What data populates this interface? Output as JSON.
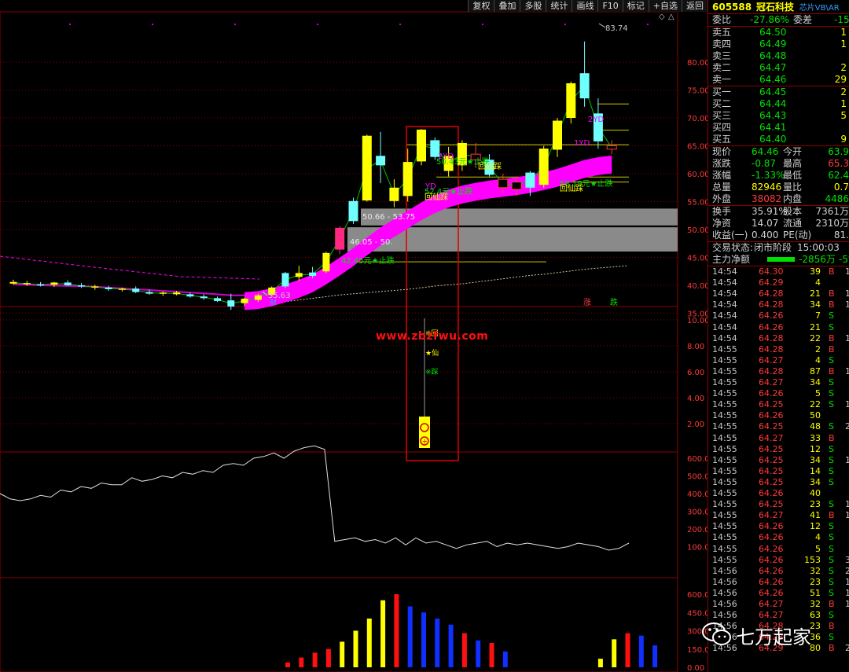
{
  "toolbar": [
    "复权",
    "叠加",
    "多股",
    "统计",
    "画线",
    "F10",
    "标记",
    "+自选",
    "返回"
  ],
  "stock": {
    "code": "605588",
    "name": "冠石科技",
    "tag": "芯片VB\\AR"
  },
  "weibi": {
    "label": "委比",
    "value": "-27.86%",
    "label2": "委差",
    "value2": "-15"
  },
  "asks": [
    {
      "label": "卖五",
      "price": "64.50",
      "vol": "1"
    },
    {
      "label": "卖四",
      "price": "64.49",
      "vol": "1"
    },
    {
      "label": "卖三",
      "price": "64.48",
      "vol": ""
    },
    {
      "label": "卖二",
      "price": "64.47",
      "vol": "2"
    },
    {
      "label": "卖一",
      "price": "64.46",
      "vol": "29"
    }
  ],
  "bids": [
    {
      "label": "买一",
      "price": "64.45",
      "vol": "2"
    },
    {
      "label": "买二",
      "price": "64.44",
      "vol": "1"
    },
    {
      "label": "买三",
      "price": "64.43",
      "vol": "5"
    },
    {
      "label": "买四",
      "price": "64.41",
      "vol": ""
    },
    {
      "label": "买五",
      "price": "64.40",
      "vol": "9"
    }
  ],
  "quote": [
    {
      "l1": "现价",
      "v1": "64.46",
      "l2": "今开",
      "v2": "63.9"
    },
    {
      "l1": "涨跌",
      "v1": "-0.87",
      "l2": "最高",
      "v2": "65.3"
    },
    {
      "l1": "涨幅",
      "v1": "-1.33%",
      "l2": "最低",
      "v2": "62.4"
    },
    {
      "l1": "总量",
      "v1": "82946",
      "l2": "量比",
      "v2": "0.7"
    },
    {
      "l1": "外盘",
      "v1": "38082",
      "l2": "内盘",
      "v2": "4486"
    }
  ],
  "stats": [
    {
      "l1": "换手",
      "v1": "35.91%",
      "l2": "股本",
      "v2": "7361万"
    },
    {
      "l1": "净资",
      "v1": "14.07",
      "l2": "流通",
      "v2": "2310万"
    },
    {
      "l1": "收益(一)",
      "v1": "0.400",
      "l2": "PE(动)",
      "v2": "81."
    }
  ],
  "status": {
    "label": "交易状态:",
    "value": "闭市阶段",
    "time": "15:00:03"
  },
  "mainflow": {
    "label": "主力净额",
    "value": "-2856万",
    "pct": "-5%"
  },
  "ticks": [
    [
      "14:54",
      "64.30",
      "39",
      "B",
      "1"
    ],
    [
      "14:54",
      "64.29",
      "4",
      "",
      ""
    ],
    [
      "14:54",
      "64.28",
      "21",
      "B",
      "1"
    ],
    [
      "14:54",
      "64.28",
      "34",
      "B",
      "1"
    ],
    [
      "14:54",
      "64.26",
      "7",
      "S",
      ""
    ],
    [
      "14:54",
      "64.26",
      "21",
      "S",
      ""
    ],
    [
      "14:54",
      "64.28",
      "22",
      "B",
      "1"
    ],
    [
      "14:55",
      "64.28",
      "2",
      "B",
      ""
    ],
    [
      "14:55",
      "64.27",
      "4",
      "S",
      ""
    ],
    [
      "14:55",
      "64.28",
      "87",
      "B",
      "1"
    ],
    [
      "14:55",
      "64.27",
      "34",
      "S",
      ""
    ],
    [
      "14:55",
      "64.26",
      "5",
      "S",
      ""
    ],
    [
      "14:55",
      "64.25",
      "22",
      "S",
      "1"
    ],
    [
      "14:55",
      "64.26",
      "50",
      "",
      ""
    ],
    [
      "14:55",
      "64.25",
      "48",
      "S",
      "2"
    ],
    [
      "14:55",
      "64.27",
      "33",
      "B",
      ""
    ],
    [
      "14:55",
      "64.25",
      "12",
      "S",
      ""
    ],
    [
      "14:55",
      "64.25",
      "34",
      "S",
      "1"
    ],
    [
      "14:55",
      "64.25",
      "14",
      "S",
      ""
    ],
    [
      "14:55",
      "64.25",
      "34",
      "S",
      ""
    ],
    [
      "14:55",
      "64.26",
      "40",
      "",
      ""
    ],
    [
      "14:55",
      "64.25",
      "23",
      "S",
      "1"
    ],
    [
      "14:55",
      "64.27",
      "41",
      "B",
      "1"
    ],
    [
      "14:55",
      "64.26",
      "12",
      "S",
      ""
    ],
    [
      "14:55",
      "64.26",
      "4",
      "S",
      ""
    ],
    [
      "14:55",
      "64.26",
      "5",
      "S",
      ""
    ],
    [
      "14:55",
      "64.26",
      "153",
      "S",
      "3"
    ],
    [
      "14:56",
      "64.26",
      "32",
      "S",
      "2"
    ],
    [
      "14:56",
      "64.26",
      "23",
      "S",
      "1"
    ],
    [
      "14:56",
      "64.26",
      "51",
      "S",
      "1"
    ],
    [
      "14:56",
      "64.27",
      "32",
      "B",
      "1"
    ],
    [
      "14:56",
      "64.27",
      "63",
      "S",
      ""
    ],
    [
      "14:56",
      "64.28",
      "23",
      "B",
      ""
    ],
    [
      "14:56",
      "64.28",
      "36",
      "S",
      ""
    ],
    [
      "14:56",
      "64.29",
      "80",
      "B",
      "2"
    ]
  ],
  "price_axis": [
    "80.00",
    "75.00",
    "70.00",
    "65.00",
    "60.00",
    "55.00",
    "50.00",
    "45.00",
    "40.00",
    "35.00"
  ],
  "ind1_axis": [
    "10.00",
    "8.00",
    "6.00",
    "4.00",
    "2.00"
  ],
  "ind2_axis": [
    "600.0",
    "500.0",
    "400.0",
    "300.0",
    "200.0",
    "100.0"
  ],
  "ind3_axis": [
    "600.0",
    "450.0",
    "300.0",
    "150.0",
    "0.00"
  ],
  "annotations": {
    "high": "83.74",
    "low": "35.63",
    "cai": "财",
    "zhang": "涨",
    "die": "跌",
    "box1": "50.66 - 53.75",
    "box2": "46.05 - 50.",
    "zhidie1": "42.45元★止跌",
    "zhidie2": "50.43元★止跌",
    "zhidie3": "52.4元★止跌",
    "zhidie4": "58.19元★止跌",
    "hxd": "回仙踩",
    "yd": "YD",
    "yd1": "1YD",
    "yd2": "2YD",
    "ind_hui": "回",
    "ind_xian": "仙",
    "ind_cai": "踩"
  },
  "watermark": "www.zbzfwu.com",
  "logo": "七万起家",
  "colors": {
    "up": "#ff3a3a",
    "down": "#00e000",
    "ma": "#ff00ff",
    "frame": "#8b0000"
  },
  "chart_data": {
    "type": "candlestick",
    "candles": [
      {
        "o": 40.6,
        "h": 41.0,
        "l": 40.1,
        "c": 40.3,
        "col": "y"
      },
      {
        "o": 40.4,
        "h": 40.8,
        "l": 39.9,
        "c": 40.2,
        "col": "y"
      },
      {
        "o": 40.2,
        "h": 40.6,
        "l": 39.8,
        "c": 40.0,
        "col": "c"
      },
      {
        "o": 40.1,
        "h": 40.6,
        "l": 39.7,
        "c": 40.5,
        "col": "y"
      },
      {
        "o": 40.5,
        "h": 40.9,
        "l": 39.9,
        "c": 40.0,
        "col": "c"
      },
      {
        "o": 40.0,
        "h": 40.4,
        "l": 39.5,
        "c": 39.8,
        "col": "c"
      },
      {
        "o": 39.8,
        "h": 40.1,
        "l": 39.2,
        "c": 39.6,
        "col": "y"
      },
      {
        "o": 39.6,
        "h": 39.9,
        "l": 39.0,
        "c": 39.3,
        "col": "c"
      },
      {
        "o": 39.2,
        "h": 39.6,
        "l": 38.9,
        "c": 39.4,
        "col": "y"
      },
      {
        "o": 39.4,
        "h": 39.8,
        "l": 38.6,
        "c": 38.8,
        "col": "c"
      },
      {
        "o": 38.8,
        "h": 39.2,
        "l": 38.3,
        "c": 38.5,
        "col": "c"
      },
      {
        "o": 38.5,
        "h": 38.9,
        "l": 38.1,
        "c": 38.7,
        "col": "y"
      },
      {
        "o": 38.7,
        "h": 39.0,
        "l": 38.2,
        "c": 38.4,
        "col": "y"
      },
      {
        "o": 38.4,
        "h": 38.7,
        "l": 37.8,
        "c": 38.0,
        "col": "c"
      },
      {
        "o": 38.0,
        "h": 38.4,
        "l": 37.4,
        "c": 37.7,
        "col": "c"
      },
      {
        "o": 37.7,
        "h": 38.0,
        "l": 37.0,
        "c": 37.2,
        "col": "c"
      },
      {
        "o": 37.3,
        "h": 38.5,
        "l": 35.6,
        "c": 36.2,
        "col": "c"
      },
      {
        "o": 36.8,
        "h": 37.8,
        "l": 36.3,
        "c": 37.6,
        "col": "y"
      },
      {
        "o": 37.4,
        "h": 38.5,
        "l": 37.0,
        "c": 38.2,
        "col": "y"
      },
      {
        "o": 38.3,
        "h": 39.8,
        "l": 38.1,
        "c": 39.6,
        "col": "y"
      },
      {
        "o": 39.8,
        "h": 42.4,
        "l": 39.5,
        "c": 42.2,
        "col": "c"
      },
      {
        "o": 42.2,
        "h": 43.5,
        "l": 40.8,
        "c": 41.5,
        "col": "y"
      },
      {
        "o": 41.7,
        "h": 43.3,
        "l": 41.3,
        "c": 42.3,
        "col": "c"
      },
      {
        "o": 42.5,
        "h": 46.0,
        "l": 42.2,
        "c": 45.8,
        "col": "y"
      },
      {
        "o": 46.4,
        "h": 50.6,
        "l": 45.6,
        "c": 50.3,
        "col": "m"
      },
      {
        "o": 51.5,
        "h": 55.7,
        "l": 51.0,
        "c": 55.1,
        "col": "c"
      },
      {
        "o": 55.2,
        "h": 67.0,
        "l": 55.0,
        "c": 66.8,
        "col": "y"
      },
      {
        "o": 63.2,
        "h": 67.5,
        "l": 58.3,
        "c": 61.5,
        "col": "c"
      },
      {
        "o": 57.5,
        "h": 59.0,
        "l": 54.0,
        "c": 55.1,
        "col": "y"
      },
      {
        "o": 56.0,
        "h": 64.5,
        "l": 55.0,
        "c": 62.1,
        "col": "y"
      },
      {
        "o": 62.2,
        "h": 68.0,
        "l": 61.5,
        "c": 67.9,
        "col": "y"
      },
      {
        "o": 66.0,
        "h": 66.5,
        "l": 62.5,
        "c": 63.0,
        "col": "c"
      },
      {
        "o": 63.2,
        "h": 64.8,
        "l": 59.5,
        "c": 60.5,
        "col": "y"
      },
      {
        "o": 61.5,
        "h": 66.0,
        "l": 60.5,
        "c": 65.5,
        "col": "y"
      },
      {
        "o": 63.5,
        "h": 65.5,
        "l": 61.0,
        "c": 62.5,
        "col": "r"
      },
      {
        "o": 62.5,
        "h": 63.5,
        "l": 59.5,
        "c": 59.8,
        "col": "c"
      },
      {
        "o": 57.5,
        "h": 60.0,
        "l": 56.5,
        "c": 59.0,
        "col": "r"
      },
      {
        "o": 58.5,
        "h": 59.5,
        "l": 56.0,
        "c": 57.2,
        "col": "r"
      },
      {
        "o": 57.5,
        "h": 60.5,
        "l": 56.0,
        "c": 60.2,
        "col": "c"
      },
      {
        "o": 58.0,
        "h": 65.0,
        "l": 57.5,
        "c": 64.5,
        "col": "y"
      },
      {
        "o": 64.3,
        "h": 70.0,
        "l": 63.0,
        "c": 69.5,
        "col": "y"
      },
      {
        "o": 70.0,
        "h": 76.5,
        "l": 69.0,
        "c": 76.2,
        "col": "y"
      },
      {
        "o": 73.5,
        "h": 83.7,
        "l": 72.0,
        "c": 78.0,
        "col": "c"
      },
      {
        "o": 70.8,
        "h": 73.5,
        "l": 64.5,
        "c": 65.8,
        "col": "c"
      },
      {
        "o": 65.0,
        "h": 66.0,
        "l": 63.5,
        "c": 64.4,
        "col": "r"
      }
    ],
    "ma_line": [
      40.2,
      40.1,
      40.0,
      39.95,
      39.9,
      39.85,
      39.75,
      39.6,
      39.45,
      39.3,
      39.15,
      39.0,
      38.85,
      38.7,
      38.55,
      38.4,
      38.2,
      38.2,
      38.4,
      38.9,
      39.6,
      40.4,
      41.4,
      42.8,
      44.4,
      46.1,
      48.0,
      49.8,
      51.3,
      52.8,
      54.3,
      55.6,
      56.6,
      57.3,
      57.8,
      58.2,
      58.5,
      58.8,
      59.2,
      59.7,
      60.3,
      61.1,
      61.9,
      62.4,
      62.7
    ],
    "slow_line": [
      36.5,
      36.8,
      37.1,
      37.4,
      37.7,
      38.0,
      38.3,
      38.5,
      38.7,
      38.9,
      39.1,
      39.3,
      39.6,
      39.9,
      40.1,
      40.3,
      40.6,
      40.9,
      41.2,
      41.5,
      41.8,
      42.0,
      42.3,
      42.6,
      42.9,
      43.1,
      43.3,
      43.5
    ],
    "ind2_line": [
      400,
      370,
      360,
      370,
      390,
      380,
      420,
      410,
      440,
      430,
      460,
      450,
      450,
      490,
      470,
      480,
      500,
      490,
      520,
      510,
      530,
      520,
      560,
      570,
      560,
      600,
      610,
      630,
      600,
      640,
      660,
      670,
      650,
      130,
      140,
      150,
      130,
      140,
      120,
      150,
      110,
      150,
      120,
      130,
      110,
      90,
      110,
      120,
      130,
      100,
      120,
      110,
      120,
      110,
      100,
      90,
      100,
      120,
      110,
      100,
      80,
      90,
      120
    ],
    "ind3_bars": [
      {
        "v": 40,
        "c": "r"
      },
      {
        "v": 80,
        "c": "r"
      },
      {
        "v": 120,
        "c": "r"
      },
      {
        "v": 150,
        "c": "r"
      },
      {
        "v": 210,
        "c": "y"
      },
      {
        "v": 300,
        "c": "y"
      },
      {
        "v": 400,
        "c": "y"
      },
      {
        "v": 550,
        "c": "y"
      },
      {
        "v": 600,
        "c": "r"
      },
      {
        "v": 500,
        "c": "b"
      },
      {
        "v": 450,
        "c": "b"
      },
      {
        "v": 400,
        "c": "b"
      },
      {
        "v": 350,
        "c": "b"
      },
      {
        "v": 280,
        "c": "r"
      },
      {
        "v": 220,
        "c": "b"
      },
      {
        "v": 200,
        "c": "r"
      },
      {
        "v": 130,
        "c": "b"
      },
      {
        "v": 0,
        "c": "y"
      },
      {
        "v": 0,
        "c": "y"
      },
      {
        "v": 0,
        "c": "y"
      },
      {
        "v": 0,
        "c": "y"
      },
      {
        "v": 0,
        "c": "y"
      },
      {
        "v": 0,
        "c": "y"
      },
      {
        "v": 70,
        "c": "y"
      },
      {
        "v": 230,
        "c": "y"
      },
      {
        "v": 280,
        "c": "r"
      },
      {
        "v": 260,
        "c": "b"
      },
      {
        "v": 180,
        "c": "b"
      }
    ]
  }
}
